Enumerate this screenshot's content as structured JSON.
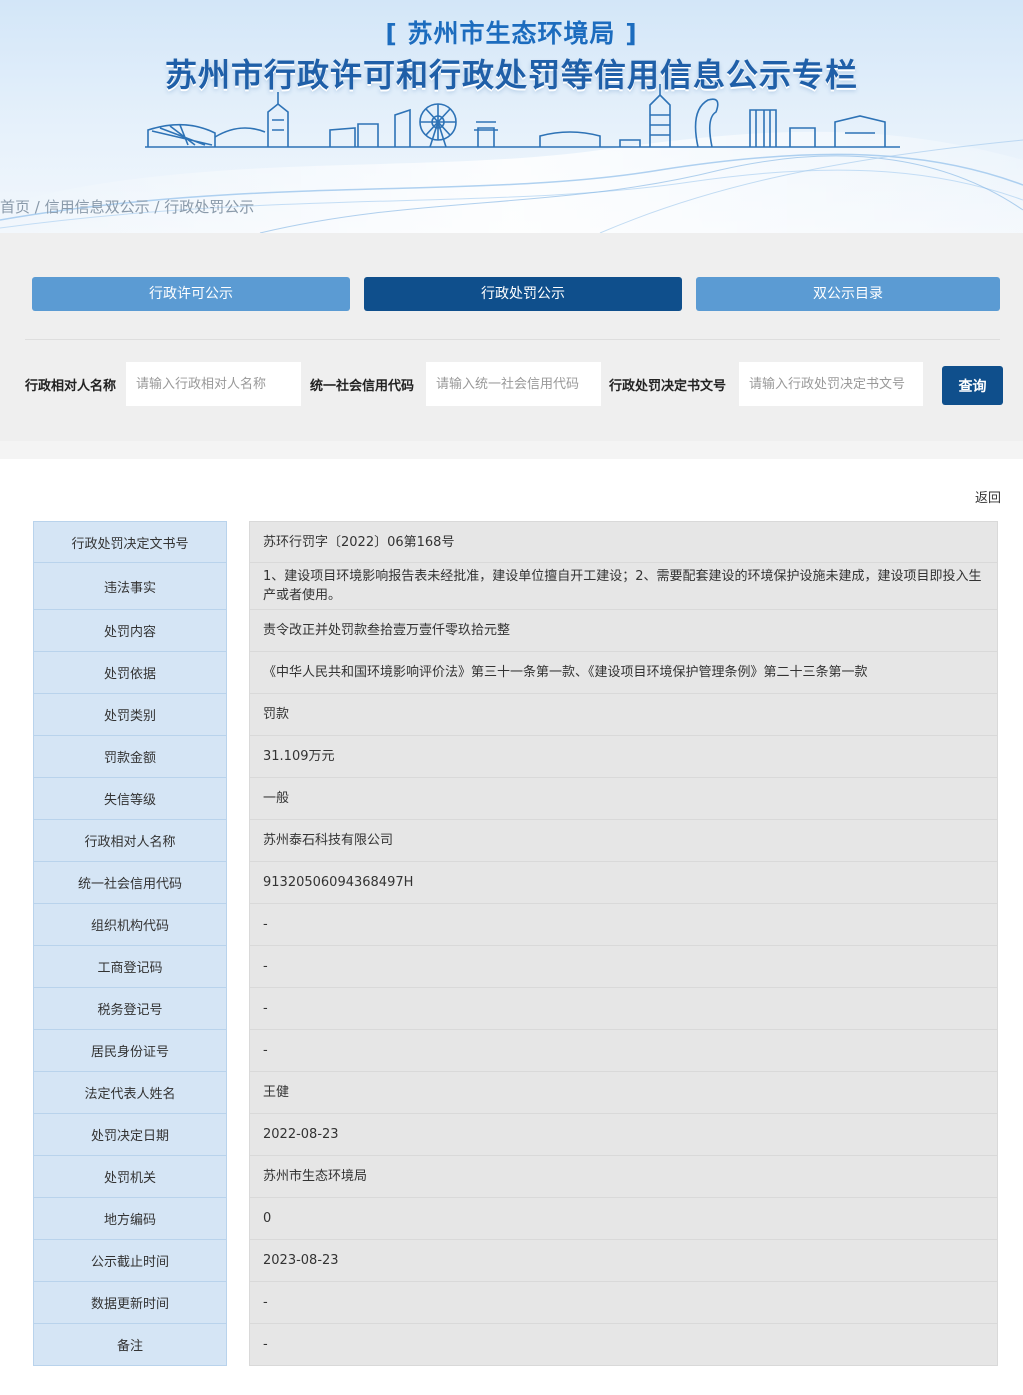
{
  "header": {
    "subtitle": "[ 苏州市生态环境局 ]",
    "title": "苏州市行政许可和行政处罚等信用信息公示专栏"
  },
  "breadcrumb": {
    "home": "首页",
    "level1": "信用信息双公示",
    "level2": "行政处罚公示",
    "separator": " / "
  },
  "tabs": [
    {
      "label": "行政许可公示",
      "active": false
    },
    {
      "label": "行政处罚公示",
      "active": true
    },
    {
      "label": "双公示目录",
      "active": false
    }
  ],
  "search": {
    "name_label": "行政相对人名称",
    "name_placeholder": "请输入行政相对人名称",
    "code_label": "统一社会信用代码",
    "code_placeholder": "请输入统一社会信用代码",
    "doc_label": "行政处罚决定书文号",
    "doc_placeholder": "请输入行政处罚决定书文号",
    "button": "查询"
  },
  "back_label": "返回",
  "details": [
    {
      "label": "行政处罚决定文书号",
      "value": "苏环行罚字〔2022〕06第168号"
    },
    {
      "label": "违法事实",
      "value": "1、建设项目环境影响报告表未经批准，建设单位擅自开工建设；2、需要配套建设的环境保护设施未建成，建设项目即投入生产或者使用。"
    },
    {
      "label": "处罚内容",
      "value": "责令改正并处罚款叁拾壹万壹仟零玖拾元整"
    },
    {
      "label": "处罚依据",
      "value": "《中华人民共和国环境影响评价法》第三十一条第一款、《建设项目环境保护管理条例》第二十三条第一款"
    },
    {
      "label": "处罚类别",
      "value": "罚款"
    },
    {
      "label": "罚款金额",
      "value": "31.109万元"
    },
    {
      "label": "失信等级",
      "value": "一般"
    },
    {
      "label": "行政相对人名称",
      "value": "苏州泰石科技有限公司"
    },
    {
      "label": "统一社会信用代码",
      "value": "91320506094368497H"
    },
    {
      "label": "组织机构代码",
      "value": "-"
    },
    {
      "label": "工商登记码",
      "value": "-"
    },
    {
      "label": "税务登记号",
      "value": "-"
    },
    {
      "label": "居民身份证号",
      "value": "-"
    },
    {
      "label": "法定代表人姓名",
      "value": "王健"
    },
    {
      "label": "处罚决定日期",
      "value": "2022-08-23"
    },
    {
      "label": "处罚机关",
      "value": "苏州市生态环境局"
    },
    {
      "label": "地方编码",
      "value": "0"
    },
    {
      "label": "公示截止时间",
      "value": "2023-08-23"
    },
    {
      "label": "数据更新时间",
      "value": "-"
    },
    {
      "label": "备注",
      "value": "-"
    }
  ],
  "colors": {
    "primary_dark": "#0f4f8c",
    "primary_light": "#5b9bd3",
    "label_bg": "#d5e5f5",
    "value_bg": "#e6e6e6"
  }
}
